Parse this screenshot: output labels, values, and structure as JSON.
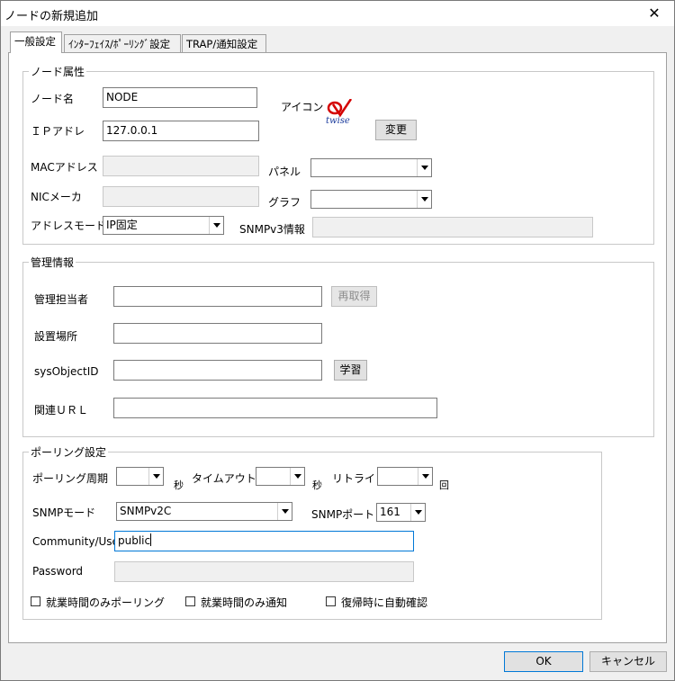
{
  "window": {
    "title": "ノードの新規追加",
    "close_glyph": "✕"
  },
  "tabs": [
    {
      "label": "一般設定"
    },
    {
      "label": "ｲﾝﾀｰﾌｪｲｽ/ﾎﾟｰﾘﾝｸﾞ設定"
    },
    {
      "label": "TRAP/通知設定"
    }
  ],
  "node_attr": {
    "legend": "ノード属性",
    "node_name_label": "ノード名",
    "node_name_value": "NODE",
    "ip_label": "ＩＰアドレ",
    "ip_value": "127.0.0.1",
    "mac_label": "MACアドレス",
    "mac_value": "",
    "nic_label": "NICメーカ",
    "nic_value": "",
    "addr_mode_label": "アドレスモード",
    "addr_mode_value": "IP固定",
    "icon_label": "アイコン",
    "icon_text": "twise",
    "change_button": "変更",
    "panel_label": "パネル",
    "panel_value": "",
    "graph_label": "グラフ",
    "graph_value": "",
    "snmpv3_label": "SNMPv3情報",
    "snmpv3_value": ""
  },
  "mgmt": {
    "legend": "管理情報",
    "admin_label": "管理担当者",
    "admin_value": "",
    "reacquire_button": "再取得",
    "location_label": "設置場所",
    "location_value": "",
    "sysobjectid_label": "sysObjectID",
    "sysobjectid_value": "",
    "learn_button": "学習",
    "url_label": "関連ＵＲＬ",
    "url_value": ""
  },
  "polling": {
    "legend": "ポーリング設定",
    "interval_label": "ポーリング周期",
    "interval_value": "",
    "sec_unit_1": "秒",
    "timeout_label": "タイムアウト",
    "timeout_value": "",
    "sec_unit_2": "秒",
    "retry_label": "リトライ",
    "retry_value": "",
    "times_unit": "回",
    "snmp_mode_label": "SNMPモード",
    "snmp_mode_value": "SNMPv2C",
    "snmp_port_label": "SNMPポート",
    "snmp_port_value": "161",
    "community_label": "Community/User",
    "community_value": "public",
    "password_label": "Password",
    "password_value": "",
    "cb_business_poll": "就業時間のみポーリング",
    "cb_business_notify": "就業時間のみ通知",
    "cb_auto_confirm": "復帰時に自動確認",
    "cb_business_poll_checked": false,
    "cb_business_notify_checked": false,
    "cb_auto_confirm_checked": false
  },
  "footer": {
    "ok_button": "OK",
    "cancel_button": "キャンセル"
  }
}
